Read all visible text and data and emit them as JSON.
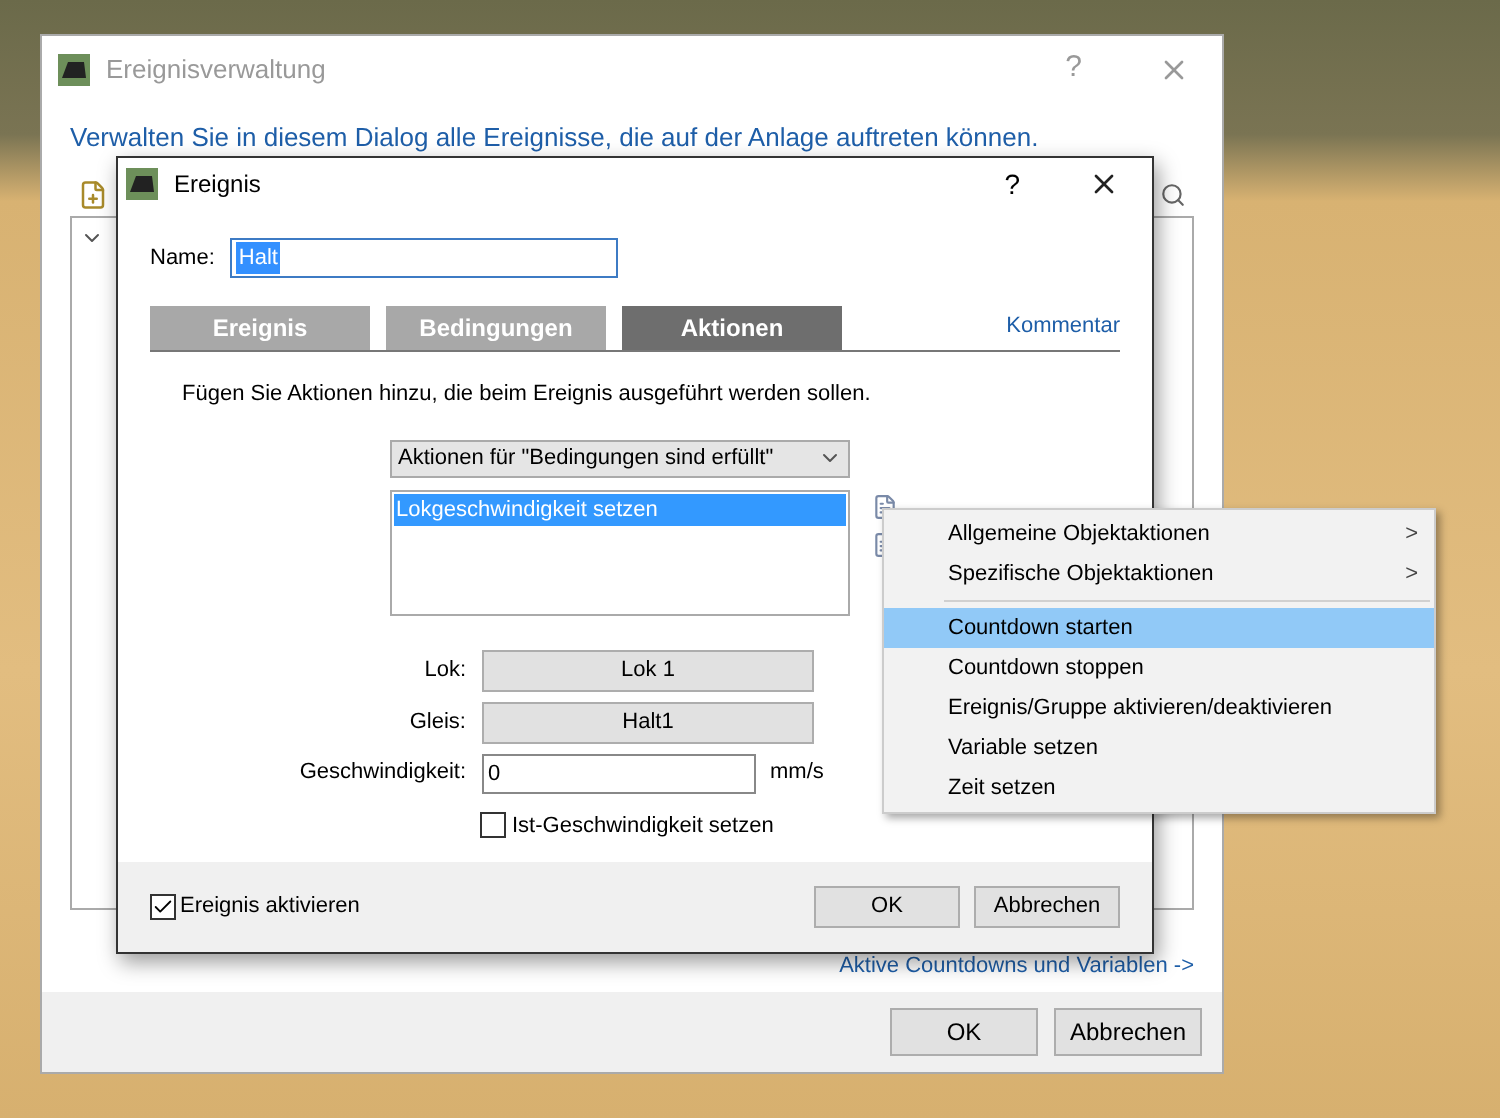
{
  "main_window": {
    "title": "Ereignisverwaltung",
    "help": "?",
    "intro": "Verwalten Sie in diesem Dialog alle Ereignisse, die auf der Anlage auftreten können.",
    "link": "Aktive Countdowns und Variablen ->",
    "buttons": [
      "OK",
      "Abbrechen"
    ]
  },
  "dialog": {
    "title": "Ereignis",
    "help": "?",
    "name_label": "Name:",
    "name_value": "Halt",
    "name_text_selected": true,
    "tabs": [
      {
        "label": "Ereignis",
        "selected": false
      },
      {
        "label": "Bedingungen",
        "selected": false
      },
      {
        "label": "Aktionen",
        "selected": true
      }
    ],
    "comment_link": "Kommentar",
    "description": "Fügen Sie Aktionen hinzu, die beim Ereignis ausgeführt werden sollen.",
    "dropdown": {
      "value": "Aktionen für \"Bedingungen sind erfüllt\""
    },
    "actions": [
      {
        "label": "Lokgeschwindigkeit setzen",
        "selected": true
      }
    ],
    "fields": [
      {
        "kind": "button",
        "label": "Lok:",
        "value": "Lok 1"
      },
      {
        "kind": "button",
        "label": "Gleis:",
        "value": "Halt1"
      },
      {
        "kind": "input",
        "label": "Geschwindigkeit:",
        "value": "0",
        "unit": "mm/s"
      }
    ],
    "set_actual": {
      "label": "Ist-Geschwindigkeit setzen",
      "checked": false
    },
    "enable": {
      "label": "Ereignis aktivieren",
      "checked": true
    },
    "buttons": [
      "OK",
      "Abbrechen"
    ]
  },
  "context_menu": {
    "items": [
      {
        "kind": "submenu",
        "label": "Allgemeine Objektaktionen",
        "arrow": ">",
        "selected": false
      },
      {
        "kind": "submenu",
        "label": "Spezifische Objektaktionen",
        "arrow": ">",
        "selected": false
      },
      {
        "kind": "separator"
      },
      {
        "kind": "item",
        "label": "Countdown starten",
        "selected": true
      },
      {
        "kind": "item",
        "label": "Countdown stoppen",
        "selected": false
      },
      {
        "kind": "item",
        "label": "Ereignis/Gruppe aktivieren/deaktivieren",
        "selected": false
      },
      {
        "kind": "item",
        "label": "Variable setzen",
        "selected": false
      },
      {
        "kind": "item",
        "label": "Zeit setzen",
        "selected": false
      }
    ]
  }
}
